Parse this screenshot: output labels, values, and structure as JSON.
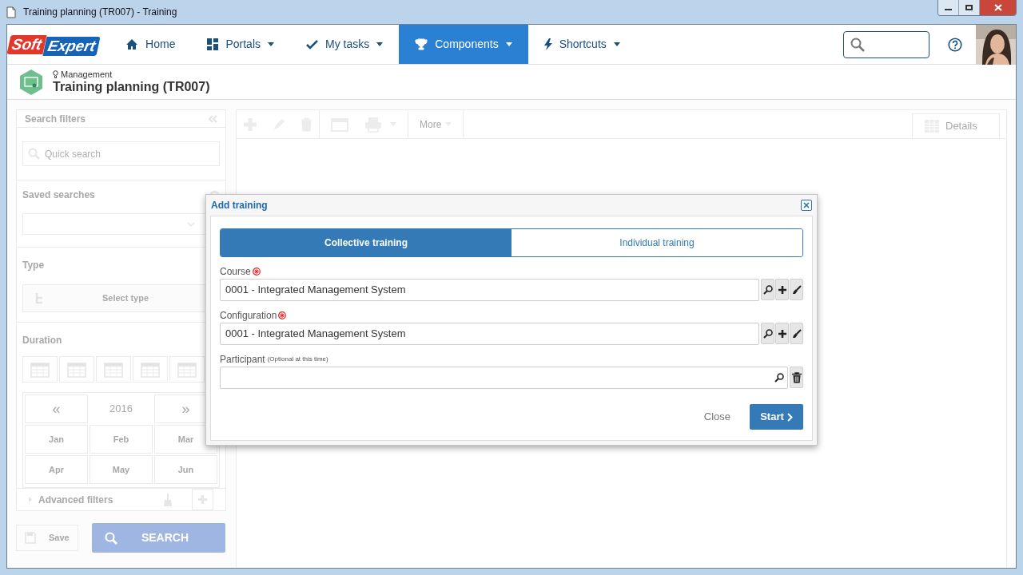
{
  "window": {
    "title": "Training planning (TR007) - Training"
  },
  "nav": {
    "logo": [
      "Soft",
      "Expert"
    ],
    "items": [
      {
        "label": "Home",
        "caret": false,
        "selected": false
      },
      {
        "label": "Portals",
        "caret": true,
        "selected": false
      },
      {
        "label": "My tasks",
        "caret": true,
        "selected": false
      },
      {
        "label": "Components",
        "caret": true,
        "selected": true
      },
      {
        "label": "Shortcuts",
        "caret": true,
        "selected": false
      }
    ]
  },
  "header": {
    "breadcrumb": "Management",
    "title": "Training planning (TR007)"
  },
  "filters": {
    "title": "Search filters",
    "quick_search": {
      "placeholder": "Quick search"
    },
    "saved_searches": "Saved searches",
    "type": {
      "label": "Type",
      "button": "Select type"
    },
    "duration": {
      "label": "Duration",
      "prev": "«",
      "year": "2016",
      "next": "»",
      "months": [
        "Jan",
        "Feb",
        "Mar",
        "Apr",
        "May",
        "Jun"
      ]
    },
    "advanced": "Advanced filters",
    "save": "Save",
    "search": "SEARCH"
  },
  "toolbar": {
    "more": "More",
    "details": "Details"
  },
  "dialog": {
    "title": "Add training",
    "tabs": [
      {
        "label": "Collective training",
        "selected": true
      },
      {
        "label": "Individual training",
        "selected": false
      }
    ],
    "fields": [
      {
        "label": "Course",
        "required": true,
        "value": "0001 - Integrated Management System",
        "kind": "lookup"
      },
      {
        "label": "Configuration",
        "required": true,
        "value": "0001 - Integrated Management System",
        "kind": "lookup"
      },
      {
        "label": "Participant",
        "note": "(Optional at this time)",
        "required": false,
        "kind": "picker"
      }
    ],
    "buttons": {
      "close": "Close",
      "start": "Start"
    }
  }
}
